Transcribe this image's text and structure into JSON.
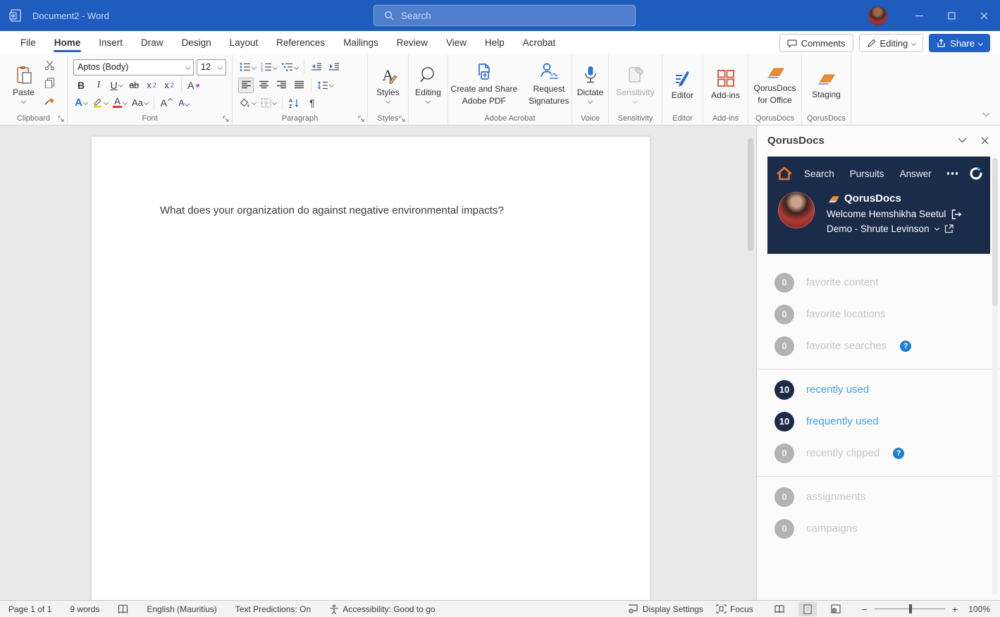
{
  "titlebar": {
    "title": "Document2 - Word",
    "search_placeholder": "Search"
  },
  "tabs": [
    "File",
    "Home",
    "Insert",
    "Draw",
    "Design",
    "Layout",
    "References",
    "Mailings",
    "Review",
    "View",
    "Help",
    "Acrobat"
  ],
  "actions": {
    "comments": "Comments",
    "editing": "Editing",
    "share": "Share"
  },
  "ribbon": {
    "paste_label": "Paste",
    "font_name": "Aptos (Body)",
    "font_size": "12",
    "change_case": "Aa",
    "styles_label": "Styles",
    "editing_label": "Editing",
    "acrobat_create_l1": "Create and Share",
    "acrobat_create_l2": "Adobe PDF",
    "acrobat_sign_l1": "Request",
    "acrobat_sign_l2": "Signatures",
    "dictate_label": "Dictate",
    "sensitivity_label": "Sensitivity",
    "editor_label": "Editor",
    "addins_label": "Add-ins",
    "qorus_office_l1": "QorusDocs",
    "qorus_office_l2": "for Office",
    "staging_label": "Staging",
    "group_labels": [
      "Clipboard",
      "Font",
      "Paragraph",
      "Styles",
      "",
      "Adobe Acrobat",
      "Voice",
      "Sensitivity",
      "Editor",
      "Add-ins",
      "QorusDocs",
      "QorusDocs"
    ]
  },
  "doc": {
    "text": "What does your organization do against negative environmental impacts?"
  },
  "panel": {
    "title": "QorusDocs",
    "nav": [
      "Search",
      "Pursuits",
      "Answer"
    ],
    "brand": "QorusDocs",
    "welcome": "Welcome Hemshikha Seetul",
    "account": "Demo - Shrute Levinson",
    "items": [
      {
        "count": "0",
        "label": "favorite content"
      },
      {
        "count": "0",
        "label": "favorite locations"
      },
      {
        "count": "0",
        "label": "favorite searches"
      },
      {
        "count": "10",
        "label": "recently used"
      },
      {
        "count": "10",
        "label": "frequently used"
      },
      {
        "count": "0",
        "label": "recently clipped"
      },
      {
        "count": "0",
        "label": "assignments"
      },
      {
        "count": "0",
        "label": "campaigns"
      }
    ]
  },
  "status": {
    "page": "Page 1 of 1",
    "words": "9 words",
    "language": "English (Mauritius)",
    "predictions": "Text Predictions: On",
    "accessibility": "Accessibility: Good to go",
    "display_settings": "Display Settings",
    "focus": "Focus",
    "zoom_level": "100%"
  },
  "colors": {
    "titlebar_blue": "#1e5cbe",
    "tab_underline_blue": "#2464c4",
    "panel_navy": "#1b2b4a",
    "brand_orange": "#e8762c",
    "link_blue": "#44a0e2",
    "help_badge_blue": "#1b7fd4",
    "disabled_circle_gray": "#b3b3b3",
    "disabled_text_gray": "#c6c6c6"
  }
}
